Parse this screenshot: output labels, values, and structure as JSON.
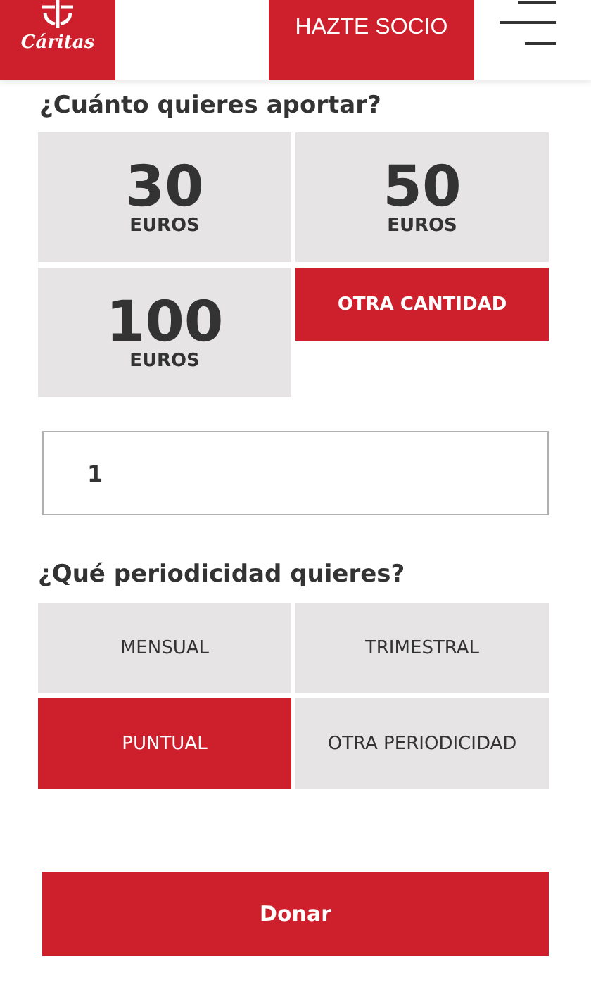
{
  "header": {
    "logo_text": "Cáritas",
    "join_button": "HAZTE SOCIO"
  },
  "amount_section": {
    "heading": "¿Cuánto quieres aportar?",
    "options": [
      {
        "kind": "amount",
        "value": "30",
        "unit": "EUROS",
        "selected": false
      },
      {
        "kind": "amount",
        "value": "50",
        "unit": "EUROS",
        "selected": false
      },
      {
        "kind": "amount",
        "value": "100",
        "unit": "EUROS",
        "selected": false
      },
      {
        "kind": "other",
        "label": "OTRA CANTIDAD",
        "selected": true
      }
    ],
    "amount_field": {
      "value": "1"
    }
  },
  "period_section": {
    "heading": "¿Qué periodicidad quieres?",
    "options": [
      {
        "label": "MENSUAL",
        "selected": false
      },
      {
        "label": "TRIMESTRAL",
        "selected": false
      },
      {
        "label": "PUNTUAL",
        "selected": true
      },
      {
        "label": "OTRA PERIODICIDAD",
        "selected": false
      }
    ]
  },
  "donate_button": "Donar"
}
